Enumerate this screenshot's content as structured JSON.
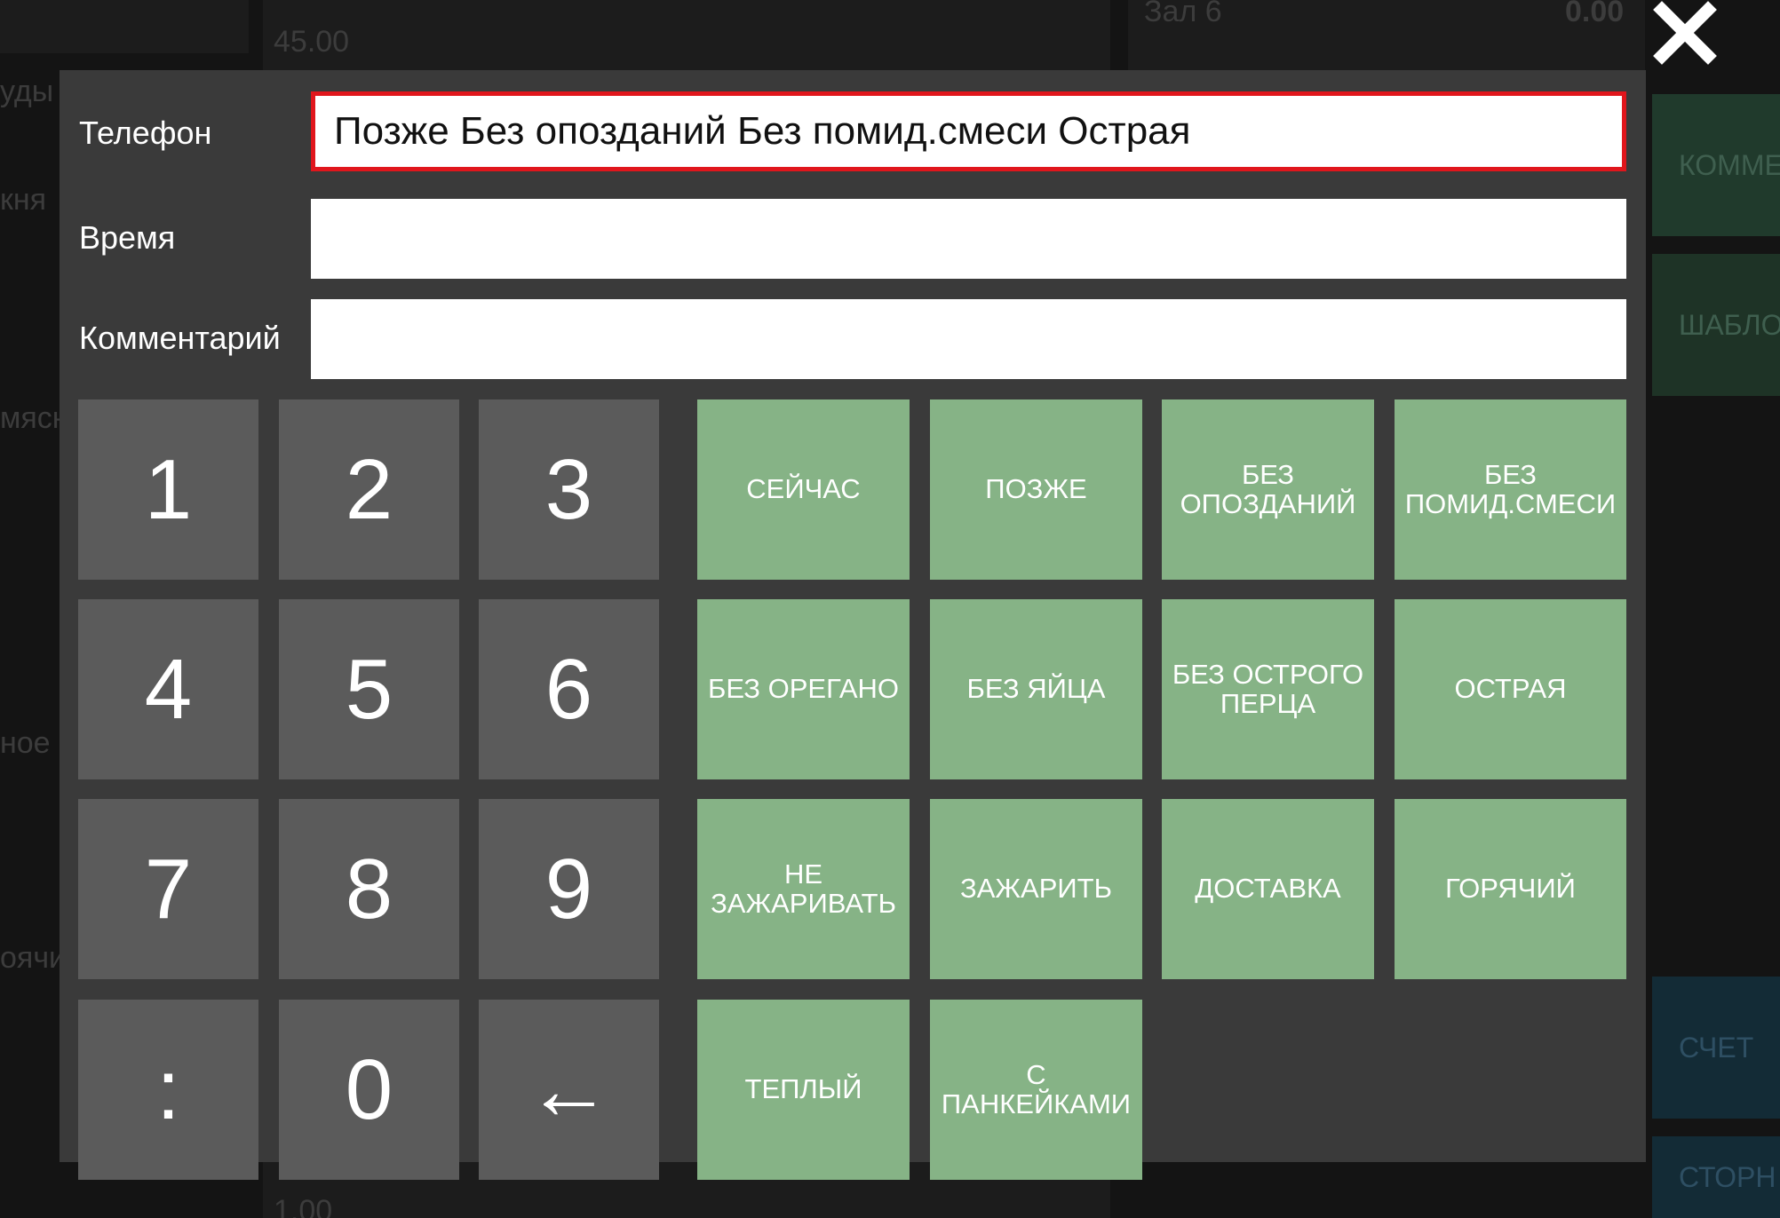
{
  "background": {
    "price_top": "45.00",
    "hall_label": "Зал 6",
    "hall_sum": "0.00",
    "price_bottom": "1.00",
    "left_fragments": [
      "уды",
      "кня",
      "мясн",
      "ное",
      "оячи"
    ],
    "right_buttons": [
      "КОММЕ",
      "ШАБЛО",
      "СЧЕТ",
      "СТОРН"
    ]
  },
  "dialog": {
    "fields": [
      {
        "label": "Телефон",
        "value": "Позже Без опозданий Без помид.смеси Острая",
        "placeholder": ""
      },
      {
        "label": "Время",
        "value": "",
        "placeholder": ""
      },
      {
        "label": "Комментарий",
        "value": "",
        "placeholder": ""
      }
    ],
    "keypad": [
      "1",
      "2",
      "3",
      "4",
      "5",
      "6",
      "7",
      "8",
      "9",
      ":",
      "0",
      "←"
    ],
    "quick_buttons": [
      "СЕЙЧАС",
      "ПОЗЖЕ",
      "БЕЗ ОПОЗДАНИЙ",
      "БЕЗ ПОМИД.СМЕСИ",
      "БЕЗ ОРЕГАНО",
      "БЕЗ ЯЙЦА",
      "БЕЗ ОСТРОГО ПЕРЦА",
      "ОСТРАЯ",
      "НЕ ЗАЖАРИВАТЬ",
      "ЗАЖАРИТЬ",
      "ДОСТАВКА",
      "ГОРЯЧИЙ",
      "ТЕПЛЫЙ",
      "С ПАНКЕЙКАМИ"
    ],
    "close_icon": "close-icon"
  },
  "colors": {
    "dialog_bg": "#3a3a3a",
    "keypad_bg": "#5b5b5b",
    "quick_button_bg": "#86b386",
    "active_border": "#e0161c"
  }
}
